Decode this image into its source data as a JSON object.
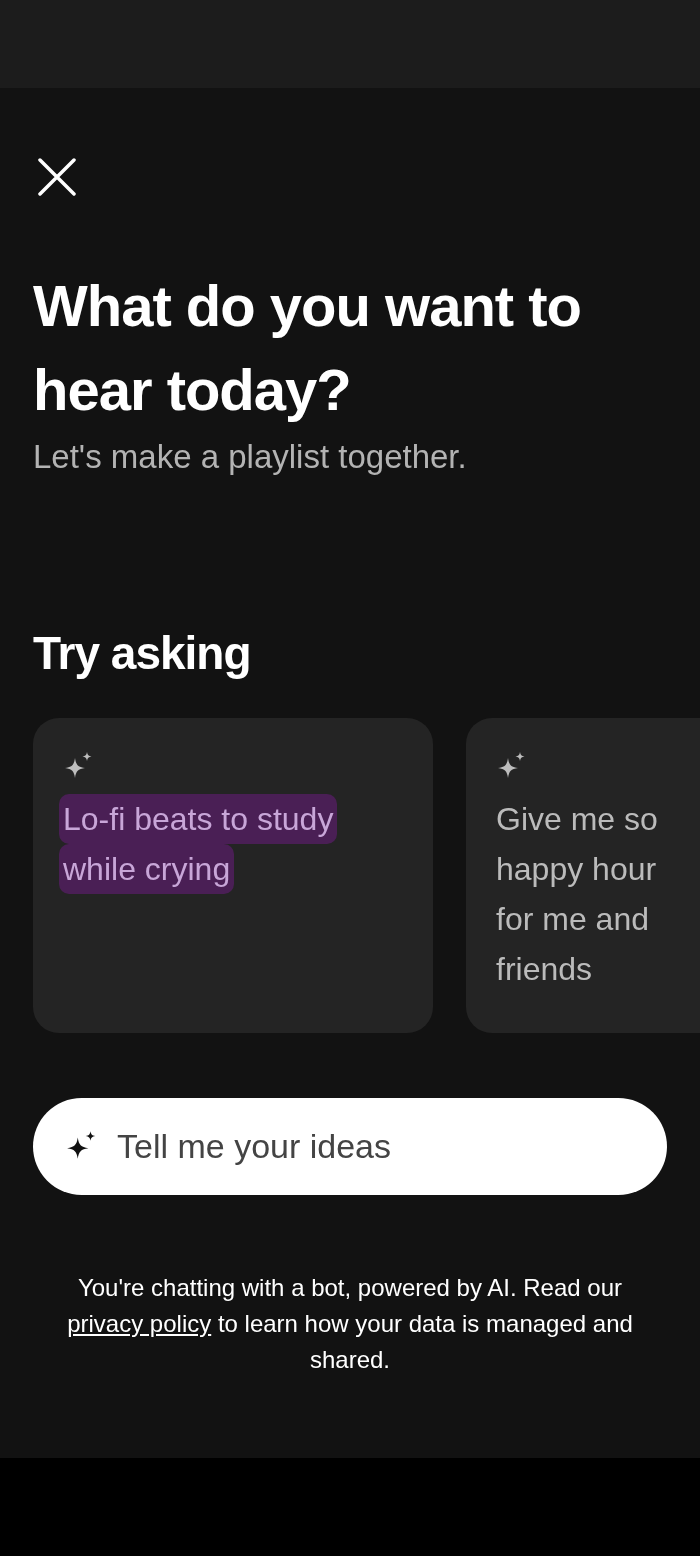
{
  "title": "What do you want to hear today?",
  "subtitle": "Let's make a playlist together.",
  "section_title": "Try asking",
  "suggestions": [
    {
      "lines": [
        "Lo-fi beats to study",
        "while crying"
      ],
      "highlighted": true
    },
    {
      "lines": [
        "Give me so",
        "happy hour",
        "for me and",
        "friends"
      ],
      "highlighted": false
    }
  ],
  "input": {
    "placeholder": "Tell me your ideas"
  },
  "disclaimer": {
    "before": "You're chatting with a bot, powered by AI. Read our",
    "link": "privacy policy",
    "after": "to learn how your data is managed and shared."
  }
}
